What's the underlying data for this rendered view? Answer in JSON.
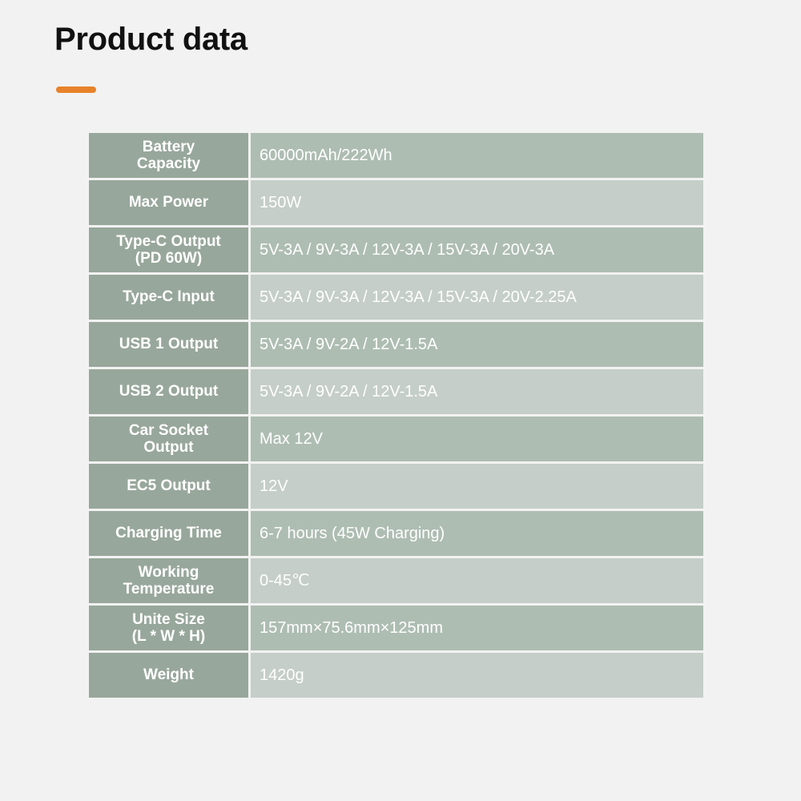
{
  "header": {
    "title": "Product data",
    "accent_color": "#e8822a"
  },
  "theme": {
    "background": "#f2f2f2",
    "label_cell": "#98a79b",
    "value_cell_light": "#c5cec8",
    "value_cell_dark": "#aebdb2",
    "text_on_cell": "#ffffff",
    "title_color": "#111111"
  },
  "spec_table": {
    "rows": [
      {
        "label": "Battery\nCapacity",
        "value": "60000mAh/222Wh"
      },
      {
        "label": "Max Power",
        "value": "150W"
      },
      {
        "label": "Type-C Output\n(PD 60W)",
        "value": "5V-3A / 9V-3A / 12V-3A / 15V-3A / 20V-3A"
      },
      {
        "label": "Type-C Input",
        "value": "5V-3A / 9V-3A / 12V-3A / 15V-3A / 20V-2.25A"
      },
      {
        "label": "USB 1 Output",
        "value": "5V-3A / 9V-2A / 12V-1.5A"
      },
      {
        "label": "USB 2 Output",
        "value": "5V-3A / 9V-2A / 12V-1.5A"
      },
      {
        "label": "Car Socket\nOutput",
        "value": "Max 12V"
      },
      {
        "label": "EC5 Output",
        "value": "12V"
      },
      {
        "label": "Charging Time",
        "value": "6-7 hours (45W Charging)"
      },
      {
        "label": "Working\nTemperature",
        "value": "0-45℃"
      },
      {
        "label": "Unite Size\n(L * W * H)",
        "value": "157mm×75.6mm×125mm"
      },
      {
        "label": "Weight",
        "value": "1420g"
      }
    ]
  }
}
